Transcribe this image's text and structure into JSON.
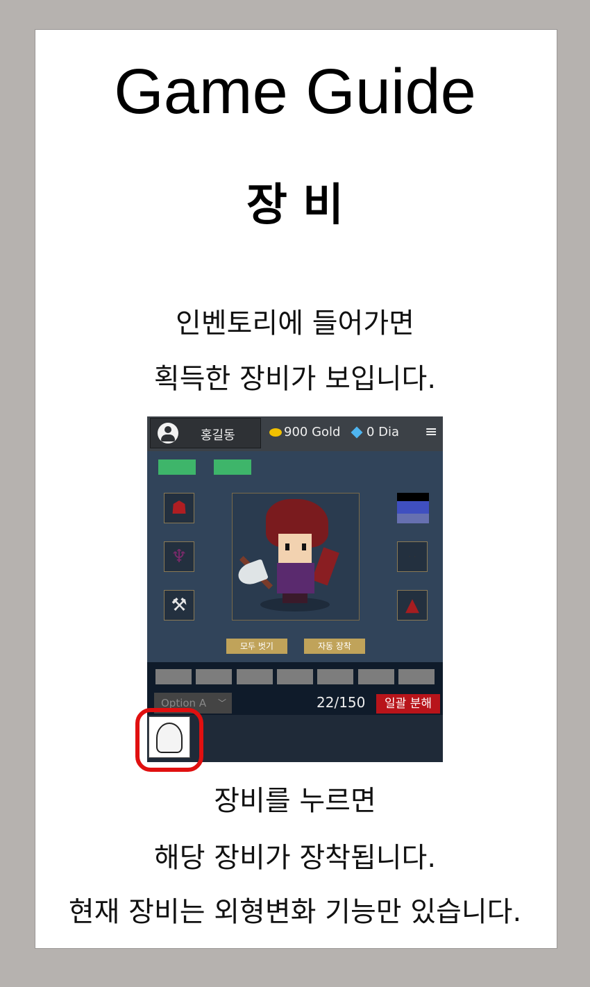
{
  "page": {
    "title": "Game Guide",
    "section_title": "장 비",
    "intro_lines": [
      "인벤토리에 들어가면",
      "획득한 장비가 보입니다."
    ],
    "outro_lines": [
      "장비를 누르면",
      "해당 장비가 장착됩니다.",
      "현재 장비는 외형변화 기능만 있습니다."
    ]
  },
  "game": {
    "header": {
      "username": "홍길동",
      "gold": "900 Gold",
      "dia": "0 Dia",
      "menu_icon": "hamburger-icon"
    },
    "equipment": {
      "unequip_all_label": "모두 벗기",
      "auto_equip_label": "자동 장착"
    },
    "inventory": {
      "filter_value": "Option A",
      "count": "22/150",
      "bulk_disassemble_label": "일괄 분해"
    },
    "colors": {
      "accent_green": "#3eb56a",
      "button_gold": "#c0a35a",
      "highlight_red": "#e01010",
      "bulk_red": "#b8141a"
    }
  }
}
